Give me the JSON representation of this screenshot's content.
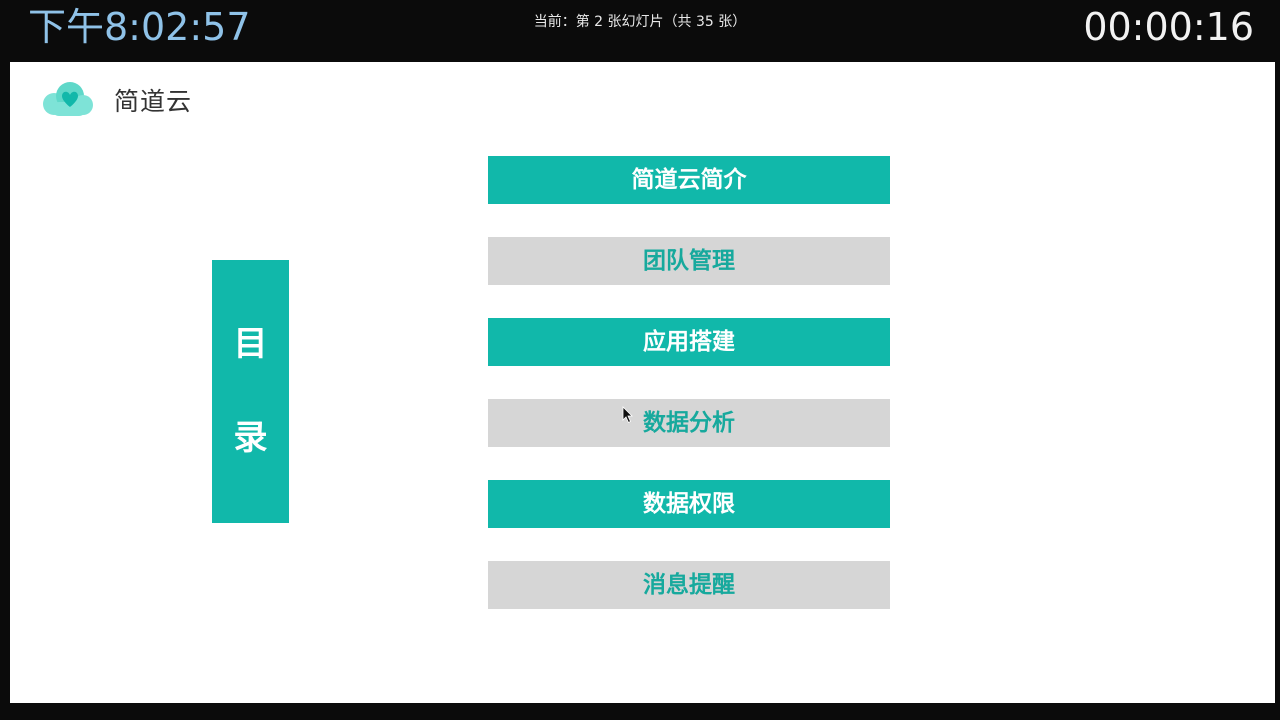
{
  "topbar": {
    "clock": "下午8:02:57",
    "slide_status": "当前：第 2 张幻灯片（共 35 张）",
    "elapsed": "00:00:16"
  },
  "slide": {
    "logo_text": "简道云",
    "toc_title": [
      "目",
      "录"
    ],
    "menu_items": [
      {
        "label": "简道云简介",
        "style": "teal"
      },
      {
        "label": "团队管理",
        "style": "grey"
      },
      {
        "label": "应用搭建",
        "style": "teal"
      },
      {
        "label": "数据分析",
        "style": "grey"
      },
      {
        "label": "数据权限",
        "style": "teal"
      },
      {
        "label": "消息提醒",
        "style": "grey"
      }
    ]
  },
  "colors": {
    "accent": "#11b8aa",
    "inactive_bg": "#d6d6d6",
    "clock": "#8fc2e8"
  }
}
